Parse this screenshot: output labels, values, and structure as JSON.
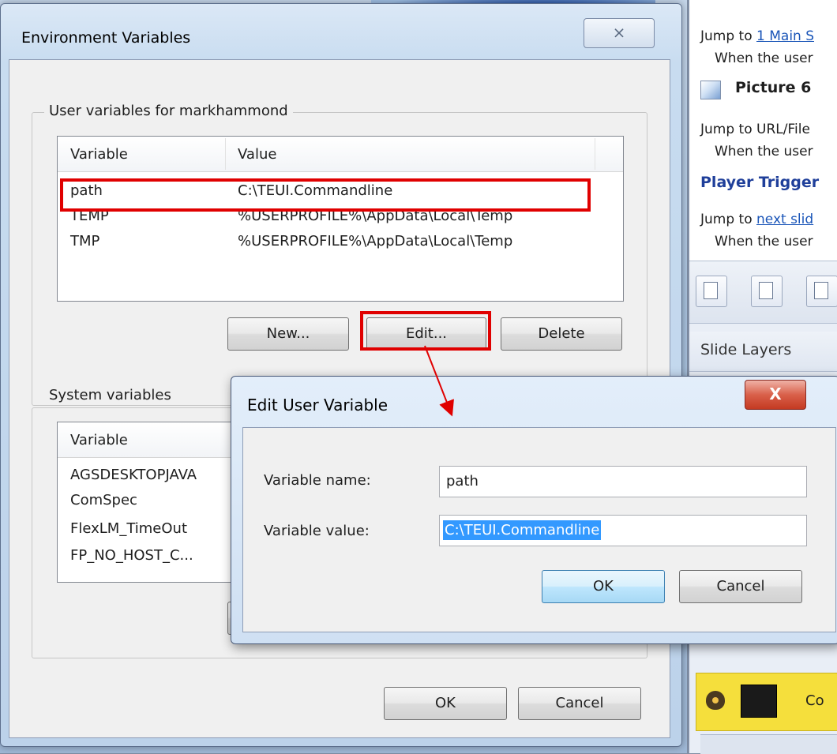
{
  "env_window": {
    "title": "Environment Variables",
    "close_label": "⨯",
    "user_group_label": "User variables for markhammond",
    "user_columns": [
      "Variable",
      "Value"
    ],
    "user_rows": [
      {
        "variable": "path",
        "value": "C:\\TEUI.Commandline"
      },
      {
        "variable": "TEMP",
        "value": "%USERPROFILE%\\AppData\\Local\\Temp"
      },
      {
        "variable": "TMP",
        "value": "%USERPROFILE%\\AppData\\Local\\Temp"
      }
    ],
    "new_label": "New...",
    "edit_label": "Edit...",
    "delete_label": "Delete",
    "system_group_label": "System variables",
    "system_columns": [
      "Variable"
    ],
    "system_rows": [
      "AGSDESKTOPJAVA",
      "ComSpec",
      "FlexLM_TimeOut",
      "FP_NO_HOST_C..."
    ],
    "ok_label": "OK",
    "cancel_label": "Cancel"
  },
  "edit_dialog": {
    "title": "Edit User Variable",
    "close_label": "X",
    "name_label": "Variable name:",
    "name_value": "path",
    "value_label": "Variable value:",
    "value_value": "C:\\TEUI.Commandline",
    "ok_label": "OK",
    "cancel_label": "Cancel"
  },
  "right_panel": {
    "jump_to_1": "Jump to",
    "link_1": "1 Main S",
    "when_1": "When the user",
    "picture_title": "Picture 6",
    "jump_url": "Jump to URL/File",
    "when_2": "When the user",
    "player_trigger": "Player Trigger",
    "jump_to_2": "Jump to",
    "link_2": "next slid",
    "when_3": "When the user",
    "slide_layers": "Slide Layers",
    "layer_name": "Co"
  },
  "colors": {
    "highlight": "#e00000",
    "selection": "#3399ff",
    "layer_bg": "#f5df3c"
  }
}
